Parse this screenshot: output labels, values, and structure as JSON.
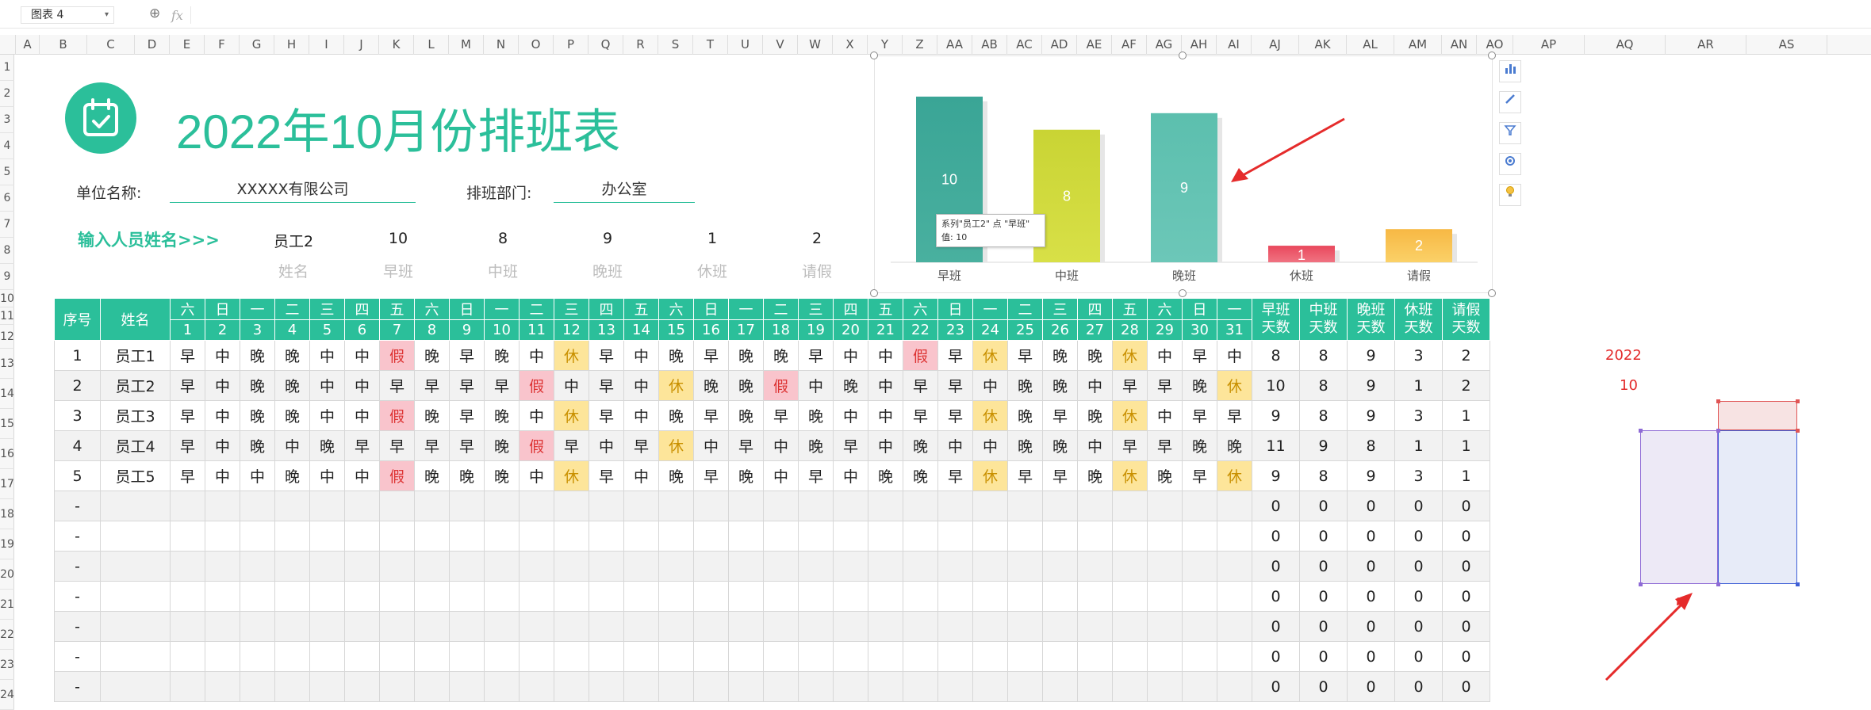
{
  "namebox": {
    "value": "图表 4"
  },
  "formula": {
    "fx": "fx"
  },
  "columns": [
    "A",
    "B",
    "C",
    "D",
    "E",
    "F",
    "G",
    "H",
    "I",
    "J",
    "K",
    "L",
    "M",
    "N",
    "O",
    "P",
    "Q",
    "R",
    "S",
    "T",
    "U",
    "V",
    "W",
    "X",
    "Y",
    "Z",
    "AA",
    "AB",
    "AC",
    "AD",
    "AE",
    "AF",
    "AG",
    "AH",
    "AI",
    "AJ",
    "AK",
    "AL",
    "AM",
    "AN",
    "AO",
    "AP",
    "AQ",
    "AR",
    "AS"
  ],
  "rows": [
    "1",
    "2",
    "3",
    "4",
    "5",
    "6",
    "7",
    "8",
    "9",
    "10",
    "11",
    "12",
    "13",
    "14",
    "15",
    "16",
    "17",
    "18",
    "19",
    "20",
    "21",
    "22",
    "23",
    "24"
  ],
  "title": "2022年10月份排班表",
  "unit_label": "单位名称:",
  "unit_value": "XXXXX有限公司",
  "dept_label": "排班部门:",
  "dept_value": "办公室",
  "input_hint": "输入人员姓名>>>",
  "summary": {
    "values": [
      "员工2",
      "10",
      "8",
      "9",
      "1",
      "2"
    ],
    "labels": [
      "姓名",
      "早班",
      "中班",
      "晚班",
      "休班",
      "请假"
    ]
  },
  "chart_data": {
    "type": "bar",
    "categories": [
      "早班",
      "中班",
      "晚班",
      "休班",
      "请假"
    ],
    "values": [
      10,
      8,
      9,
      1,
      2
    ],
    "colors": [
      "#3aa596",
      "#c9d434",
      "#5cbfae",
      "#e9485c",
      "#f7b844"
    ],
    "colors_light": [
      "#49b09f",
      "#d8e047",
      "#6cc7b8",
      "#f07382",
      "#fbd168"
    ],
    "ylim": [
      0,
      11
    ],
    "grid": false,
    "title": "",
    "xlabel": "",
    "ylabel": ""
  },
  "tooltip": {
    "line1": "系列\"员工2\" 点 \"早班\"",
    "line2": "值: 10"
  },
  "table": {
    "col_no": "序号",
    "col_name": "姓名",
    "weekdays": [
      "六",
      "日",
      "一",
      "二",
      "三",
      "四",
      "五",
      "六",
      "日",
      "一",
      "二",
      "三",
      "四",
      "五",
      "六",
      "日",
      "一",
      "二",
      "三",
      "四",
      "五",
      "六",
      "日",
      "一",
      "二",
      "三",
      "四",
      "五",
      "六",
      "日",
      "一"
    ],
    "days": [
      "1",
      "2",
      "3",
      "4",
      "5",
      "6",
      "7",
      "8",
      "9",
      "10",
      "11",
      "12",
      "13",
      "14",
      "15",
      "16",
      "17",
      "18",
      "19",
      "20",
      "21",
      "22",
      "23",
      "24",
      "25",
      "26",
      "27",
      "28",
      "29",
      "30",
      "31"
    ],
    "stat_headers": [
      [
        "早班",
        "天数"
      ],
      [
        "中班",
        "天数"
      ],
      [
        "晚班",
        "天数"
      ],
      [
        "休班",
        "天数"
      ],
      [
        "请假",
        "天数"
      ]
    ],
    "rows": [
      {
        "no": "1",
        "name": "员工1",
        "shifts": [
          "早",
          "中",
          "晚",
          "晚",
          "中",
          "中",
          "假",
          "晚",
          "早",
          "晚",
          "中",
          "休",
          "早",
          "中",
          "晚",
          "早",
          "晚",
          "晚",
          "早",
          "中",
          "中",
          "假",
          "早",
          "休",
          "早",
          "晚",
          "晚",
          "休",
          "中",
          "早",
          "中"
        ],
        "stats": [
          "8",
          "8",
          "9",
          "3",
          "2"
        ]
      },
      {
        "no": "2",
        "name": "员工2",
        "shifts": [
          "早",
          "中",
          "晚",
          "晚",
          "中",
          "中",
          "早",
          "早",
          "早",
          "早",
          "假",
          "中",
          "早",
          "中",
          "休",
          "晚",
          "晚",
          "假",
          "中",
          "晚",
          "中",
          "早",
          "早",
          "中",
          "晚",
          "晚",
          "中",
          "早",
          "早",
          "晚",
          "休"
        ],
        "stats": [
          "10",
          "8",
          "9",
          "1",
          "2"
        ]
      },
      {
        "no": "3",
        "name": "员工3",
        "shifts": [
          "早",
          "中",
          "晚",
          "晚",
          "中",
          "中",
          "假",
          "晚",
          "早",
          "晚",
          "中",
          "休",
          "早",
          "中",
          "晚",
          "早",
          "晚",
          "早",
          "晚",
          "中",
          "中",
          "早",
          "早",
          "休",
          "晚",
          "早",
          "晚",
          "休",
          "中",
          "早",
          "早"
        ],
        "stats": [
          "9",
          "8",
          "9",
          "3",
          "1"
        ]
      },
      {
        "no": "4",
        "name": "员工4",
        "shifts": [
          "早",
          "中",
          "晚",
          "中",
          "晚",
          "早",
          "早",
          "早",
          "早",
          "晚",
          "假",
          "早",
          "中",
          "早",
          "休",
          "中",
          "早",
          "中",
          "晚",
          "早",
          "中",
          "晚",
          "中",
          "中",
          "晚",
          "晚",
          "中",
          "早",
          "早",
          "晚",
          "晚"
        ],
        "stats": [
          "11",
          "9",
          "8",
          "1",
          "1"
        ]
      },
      {
        "no": "5",
        "name": "员工5",
        "shifts": [
          "早",
          "中",
          "中",
          "晚",
          "中",
          "中",
          "假",
          "晚",
          "晚",
          "晚",
          "中",
          "休",
          "早",
          "中",
          "晚",
          "早",
          "晚",
          "中",
          "早",
          "中",
          "晚",
          "晚",
          "早",
          "休",
          "早",
          "早",
          "晚",
          "休",
          "晚",
          "早",
          "休"
        ],
        "stats": [
          "9",
          "8",
          "9",
          "3",
          "1"
        ]
      },
      {
        "no": "-",
        "name": "",
        "shifts": [
          "",
          "",
          "",
          "",
          "",
          "",
          "",
          "",
          "",
          "",
          "",
          "",
          "",
          "",
          "",
          "",
          "",
          "",
          "",
          "",
          "",
          "",
          "",
          "",
          "",
          "",
          "",
          "",
          "",
          "",
          ""
        ],
        "stats": [
          "0",
          "0",
          "0",
          "0",
          "0"
        ]
      },
      {
        "no": "-",
        "name": "",
        "shifts": [
          "",
          "",
          "",
          "",
          "",
          "",
          "",
          "",
          "",
          "",
          "",
          "",
          "",
          "",
          "",
          "",
          "",
          "",
          "",
          "",
          "",
          "",
          "",
          "",
          "",
          "",
          "",
          "",
          "",
          "",
          ""
        ],
        "stats": [
          "0",
          "0",
          "0",
          "0",
          "0"
        ]
      },
      {
        "no": "-",
        "name": "",
        "shifts": [
          "",
          "",
          "",
          "",
          "",
          "",
          "",
          "",
          "",
          "",
          "",
          "",
          "",
          "",
          "",
          "",
          "",
          "",
          "",
          "",
          "",
          "",
          "",
          "",
          "",
          "",
          "",
          "",
          "",
          "",
          ""
        ],
        "stats": [
          "0",
          "0",
          "0",
          "0",
          "0"
        ]
      },
      {
        "no": "-",
        "name": "",
        "shifts": [
          "",
          "",
          "",
          "",
          "",
          "",
          "",
          "",
          "",
          "",
          "",
          "",
          "",
          "",
          "",
          "",
          "",
          "",
          "",
          "",
          "",
          "",
          "",
          "",
          "",
          "",
          "",
          "",
          "",
          "",
          ""
        ],
        "stats": [
          "0",
          "0",
          "0",
          "0",
          "0"
        ]
      },
      {
        "no": "-",
        "name": "",
        "shifts": [
          "",
          "",
          "",
          "",
          "",
          "",
          "",
          "",
          "",
          "",
          "",
          "",
          "",
          "",
          "",
          "",
          "",
          "",
          "",
          "",
          "",
          "",
          "",
          "",
          "",
          "",
          "",
          "",
          "",
          "",
          ""
        ],
        "stats": [
          "0",
          "0",
          "0",
          "0",
          "0"
        ]
      },
      {
        "no": "-",
        "name": "",
        "shifts": [
          "",
          "",
          "",
          "",
          "",
          "",
          "",
          "",
          "",
          "",
          "",
          "",
          "",
          "",
          "",
          "",
          "",
          "",
          "",
          "",
          "",
          "",
          "",
          "",
          "",
          "",
          "",
          "",
          "",
          "",
          ""
        ],
        "stats": [
          "0",
          "0",
          "0",
          "0",
          "0"
        ]
      },
      {
        "no": "-",
        "name": "",
        "shifts": [
          "",
          "",
          "",
          "",
          "",
          "",
          "",
          "",
          "",
          "",
          "",
          "",
          "",
          "",
          "",
          "",
          "",
          "",
          "",
          "",
          "",
          "",
          "",
          "",
          "",
          "",
          "",
          "",
          "",
          "",
          ""
        ],
        "stats": [
          "0",
          "0",
          "0",
          "0",
          "0"
        ]
      }
    ]
  },
  "side_values": {
    "year": "2022",
    "month": "10"
  },
  "accent": "#2bbf9a",
  "icons": {
    "chart_tools": [
      "bar-chart-icon",
      "pen-icon",
      "filter-icon",
      "gear-icon",
      "bulb-icon"
    ]
  }
}
